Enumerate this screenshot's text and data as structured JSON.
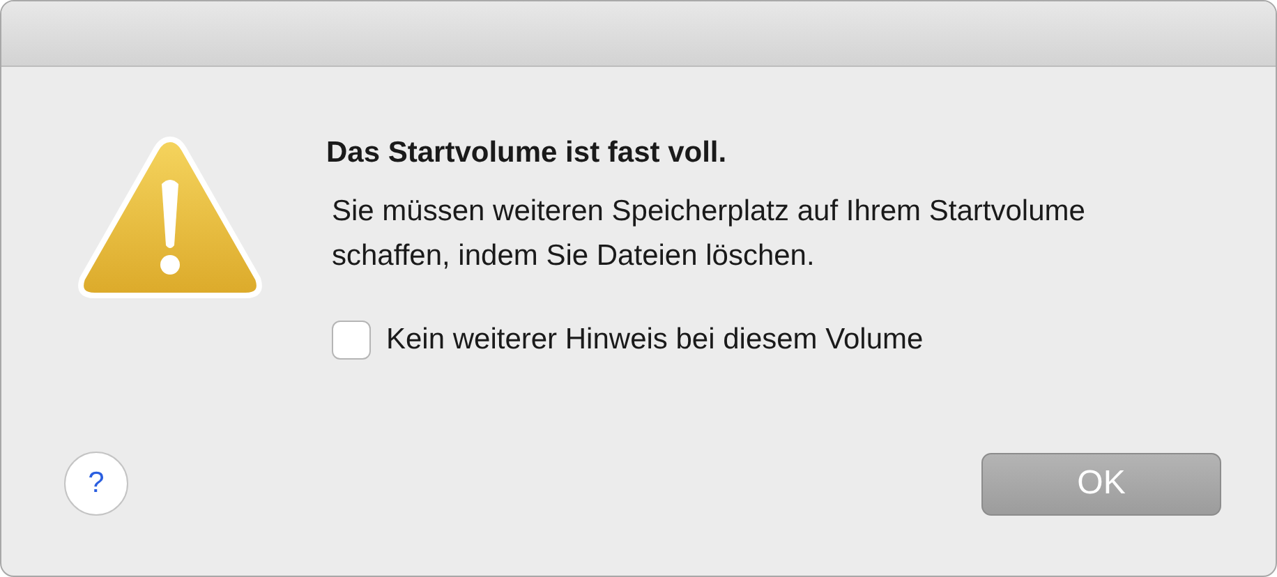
{
  "dialog": {
    "title": "Das Startvolume ist fast voll.",
    "message": "Sie müssen weiteren Speicherplatz auf Ihrem Startvolume schaffen, indem Sie Dateien löschen.",
    "checkbox": {
      "label": "Kein weiterer Hinweis bei diesem Volume",
      "checked": false
    },
    "help_button": "?",
    "buttons": [
      "OK"
    ]
  }
}
